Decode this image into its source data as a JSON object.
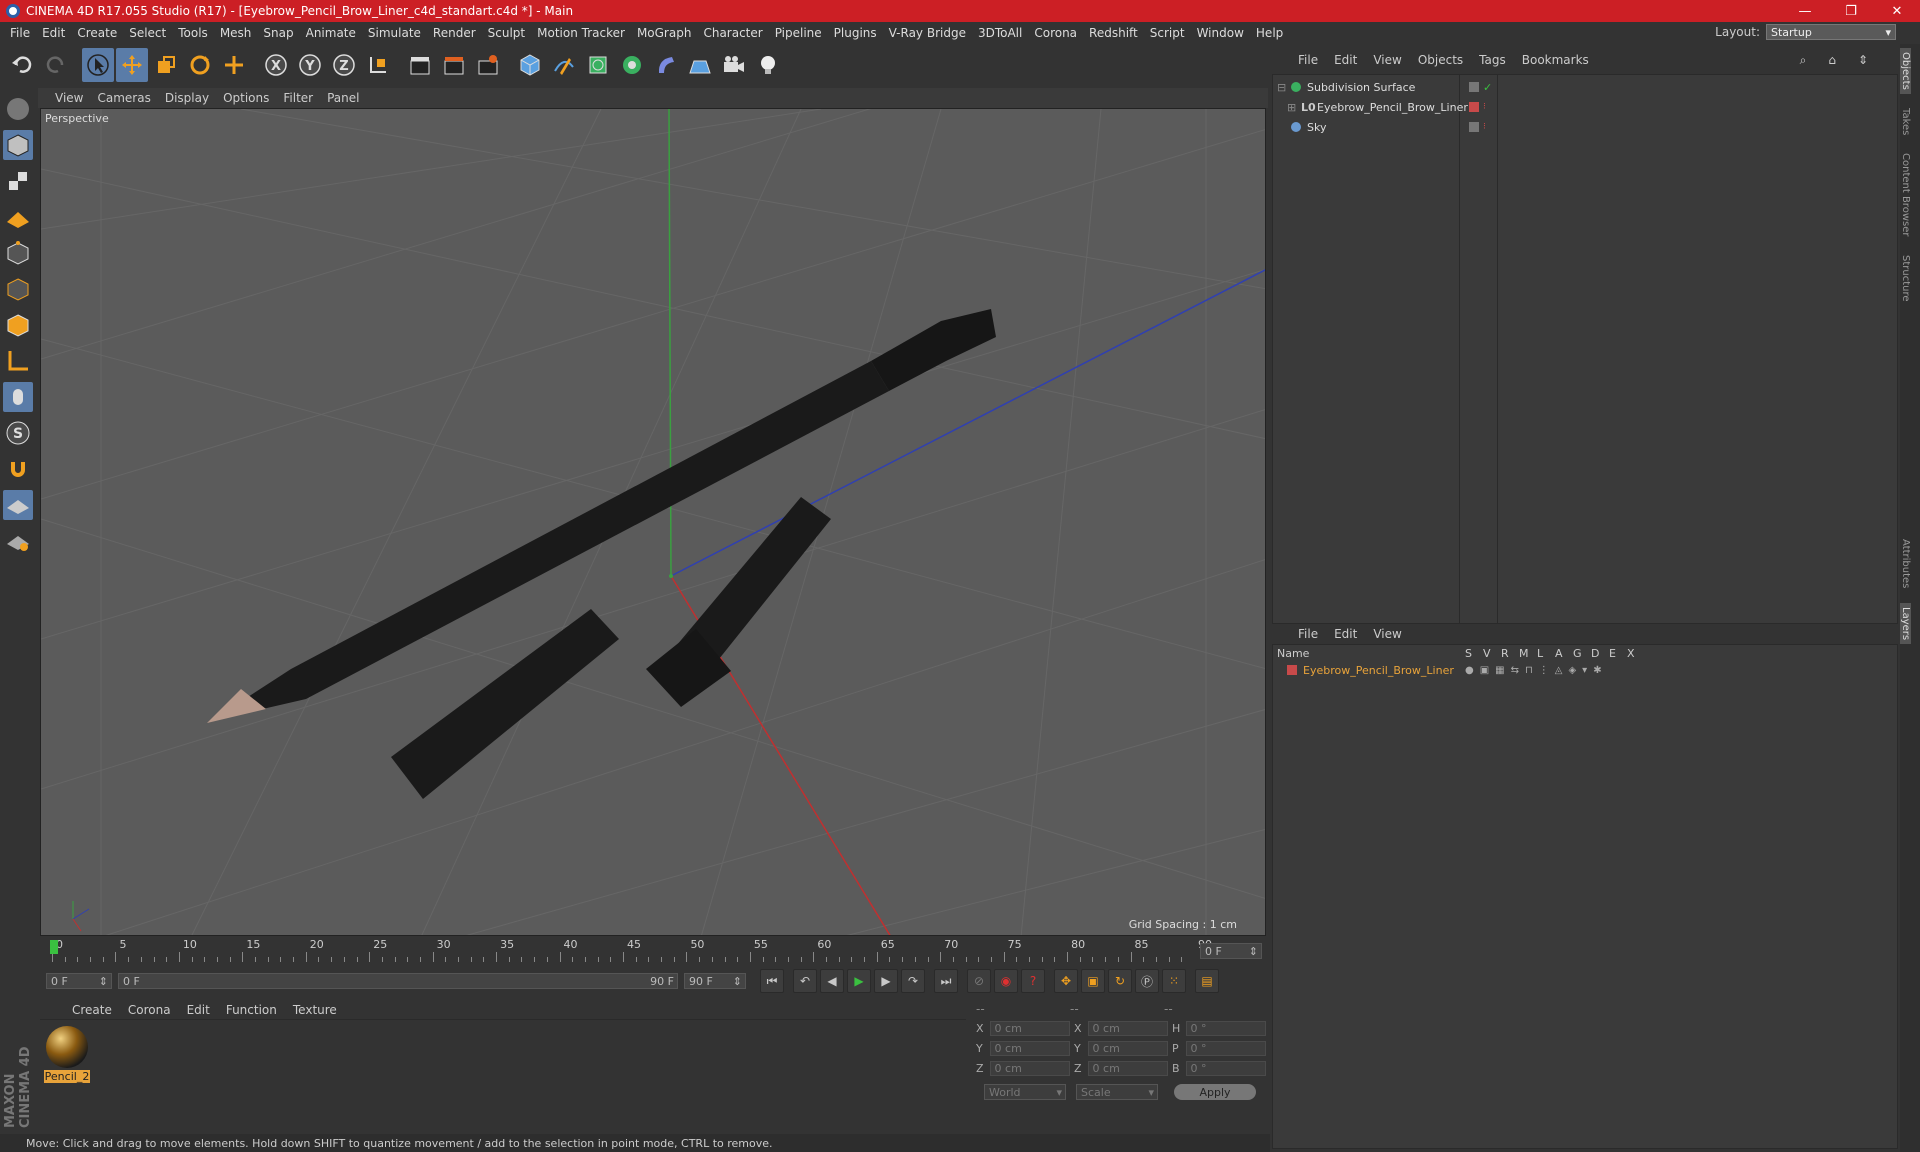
{
  "window": {
    "title": "CINEMA 4D R17.055 Studio (R17) - [Eyebrow_Pencil_Brow_Liner_c4d_standart.c4d *] - Main",
    "controls": [
      "—",
      "❐",
      "✕"
    ]
  },
  "menubar": {
    "items": [
      "File",
      "Edit",
      "Create",
      "Select",
      "Tools",
      "Mesh",
      "Snap",
      "Animate",
      "Simulate",
      "Render",
      "Sculpt",
      "Motion Tracker",
      "MoGraph",
      "Character",
      "Pipeline",
      "Plugins",
      "V-Ray Bridge",
      "3DToAll",
      "Corona",
      "Redshift",
      "Script",
      "Window",
      "Help"
    ]
  },
  "layout": {
    "label": "Layout:",
    "value": "Startup"
  },
  "viewport": {
    "menu": [
      "View",
      "Cameras",
      "Display",
      "Options",
      "Filter",
      "Panel"
    ],
    "label": "Perspective",
    "grid_spacing": "Grid Spacing : 1 cm"
  },
  "timeline": {
    "ticks": [
      "0",
      "5",
      "10",
      "15",
      "20",
      "25",
      "30",
      "35",
      "40",
      "45",
      "50",
      "55",
      "60",
      "65",
      "70",
      "75",
      "80",
      "85",
      "90"
    ],
    "current_frame": "0 F",
    "start_field": "0 F",
    "range_start": "0 F",
    "range_end": "90 F",
    "end_field": "90 F"
  },
  "materials": {
    "menu": [
      "Create",
      "Corona",
      "Edit",
      "Function",
      "Texture"
    ],
    "items": [
      {
        "name": "Pencil_2"
      }
    ]
  },
  "coords": {
    "headers": [
      "--",
      "--",
      "--"
    ],
    "rows": [
      {
        "a": "X",
        "av": "0 cm",
        "b": "X",
        "bv": "0 cm",
        "c": "H",
        "cv": "0 °"
      },
      {
        "a": "Y",
        "av": "0 cm",
        "b": "Y",
        "bv": "0 cm",
        "c": "P",
        "cv": "0 °"
      },
      {
        "a": "Z",
        "av": "0 cm",
        "b": "Z",
        "bv": "0 cm",
        "c": "B",
        "cv": "0 °"
      }
    ],
    "world": "World",
    "scale": "Scale",
    "apply": "Apply"
  },
  "status": "Move: Click and drag to move elements. Hold down SHIFT to quantize movement / add to the selection in point mode, CTRL to remove.",
  "objects_panel": {
    "menu": [
      "File",
      "Edit",
      "View",
      "Objects",
      "Tags",
      "Bookmarks"
    ],
    "items": [
      {
        "name": "Subdivision Surface"
      },
      {
        "name": "Eyebrow_Pencil_Brow_Liner"
      },
      {
        "name": "Sky"
      }
    ]
  },
  "layers_panel": {
    "menu": [
      "File",
      "Edit",
      "View"
    ],
    "columns": [
      "Name",
      "S",
      "V",
      "R",
      "M",
      "L",
      "A",
      "G",
      "D",
      "E",
      "X"
    ],
    "items": [
      {
        "name": "Eyebrow_Pencil_Brow_Liner",
        "color": "#c84a4a"
      }
    ]
  },
  "side_tabs": [
    "Objects",
    "Takes",
    "Content Browser",
    "Structure",
    "Attributes",
    "Layers"
  ],
  "brand": "MAXON CINEMA 4D",
  "colors": {
    "titlebar": "#cc1f25",
    "accent": "#5a7ca8",
    "selected_text": "#e8a33a"
  }
}
